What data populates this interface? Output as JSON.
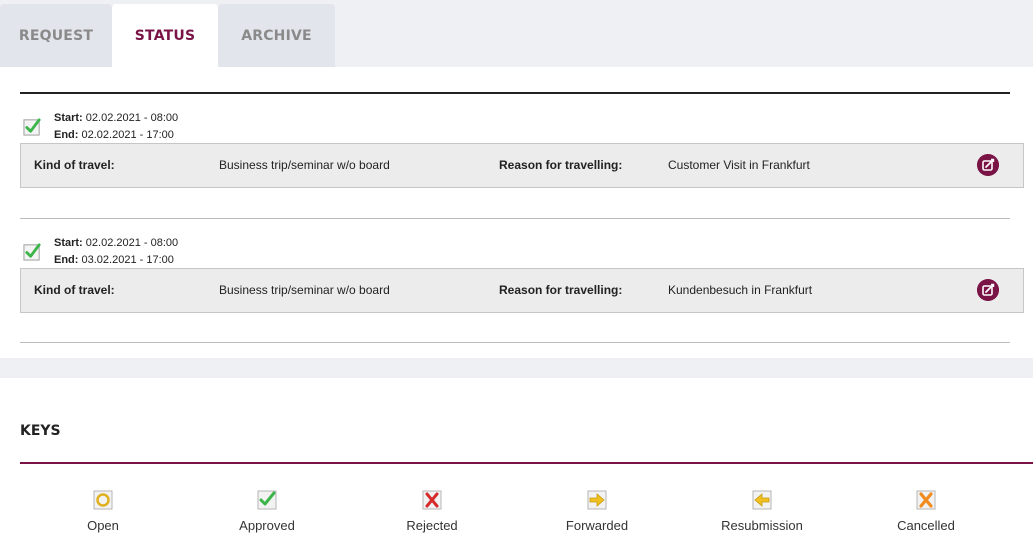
{
  "tabs": {
    "request": "REQUEST",
    "status": "STATUS",
    "archive": "ARCHIVE",
    "active": "status"
  },
  "entries": [
    {
      "status_icon": "approved-check-icon",
      "start_label": "Start:",
      "start_value": "02.02.2021 - 08:00",
      "end_label": "End:",
      "end_value": "02.02.2021 - 17:00",
      "kind_label": "Kind of travel:",
      "kind_value": "Business trip/seminar w/o board",
      "reason_label": "Reason for travelling:",
      "reason_value": "Customer Visit in Frankfurt"
    },
    {
      "status_icon": "approved-check-icon",
      "start_label": "Start:",
      "start_value": "02.02.2021 - 08:00",
      "end_label": "End:",
      "end_value": "03.02.2021 - 17:00",
      "kind_label": "Kind of travel:",
      "kind_value": "Business trip/seminar w/o board",
      "reason_label": "Reason for travelling:",
      "reason_value": "Kundenbesuch in Frankfurt"
    }
  ],
  "keys": {
    "title": "KEYS",
    "items": [
      {
        "label": "Open",
        "icon": "open-circle-icon"
      },
      {
        "label": "Approved",
        "icon": "approved-check-icon"
      },
      {
        "label": "Rejected",
        "icon": "rejected-x-icon"
      },
      {
        "label": "Forwarded",
        "icon": "forwarded-arrow-icon"
      },
      {
        "label": "Resubmission",
        "icon": "resubmission-arrow-icon"
      },
      {
        "label": "Cancelled",
        "icon": "cancelled-x-icon"
      }
    ]
  },
  "colors": {
    "accent": "#7a1446",
    "approved": "#3cb54a",
    "rejected": "#d62b2b",
    "forwarded": "#f0c020",
    "cancelled": "#f08c20",
    "tab_bg": "#e2e5ec"
  }
}
